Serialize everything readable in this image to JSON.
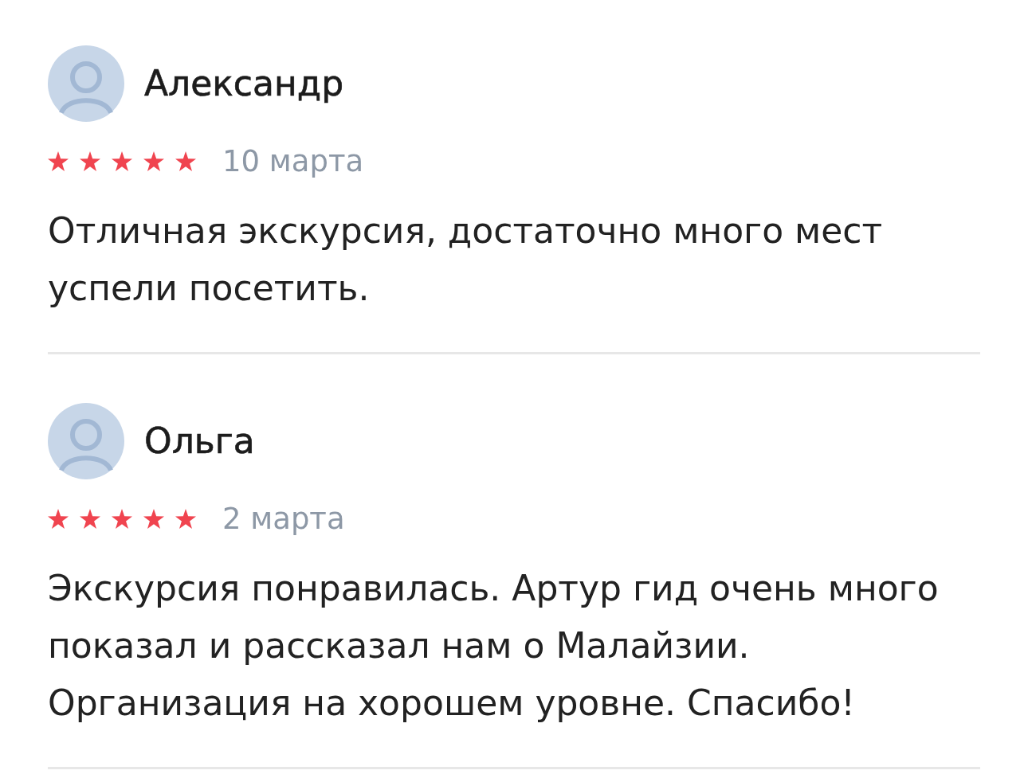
{
  "reviews": [
    {
      "author": "Александр",
      "stars": 5,
      "date": "10 марта",
      "text": "Отличная экскурсия, достаточно много мест успели посетить."
    },
    {
      "author": "Ольга",
      "stars": 5,
      "date": "2 марта",
      "text": "Экскурсия понравилась. Артур гид очень много показал и рассказал нам о Малайзии. Организация на хорошем уровне. Спасибо!"
    }
  ]
}
